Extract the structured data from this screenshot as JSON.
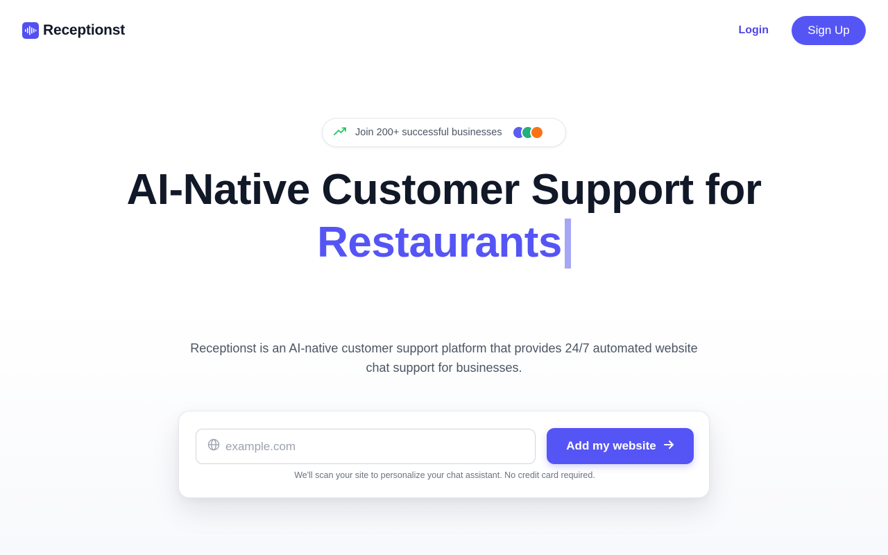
{
  "header": {
    "brand_name": "Receptionst",
    "login_label": "Login",
    "signup_label": "Sign Up"
  },
  "badge": {
    "text": "Join 200+ successful businesses",
    "avatar_colors": [
      "#5a5cf2",
      "#22b07d",
      "#f97316"
    ]
  },
  "hero": {
    "title_line1": "AI-Native Customer Support for",
    "highlight_word": "Restaurants"
  },
  "subtitle": "Receptionst is an AI-native customer support platform that provides 24/7 automated website chat support for businesses.",
  "signup_card": {
    "input_placeholder": "example.com",
    "input_value": "",
    "button_label": "Add my website",
    "note": "We'll scan your site to personalize your chat assistant. No credit card required."
  },
  "colors": {
    "accent": "#5555f5",
    "link": "#4f46e5",
    "heading": "#111827",
    "body_text": "#4b5563",
    "trend_icon": "#22c55e"
  },
  "icons": {
    "logo": "audio-wave-icon",
    "badge": "trending-up-icon",
    "input": "globe-icon",
    "button": "arrow-right-icon"
  }
}
